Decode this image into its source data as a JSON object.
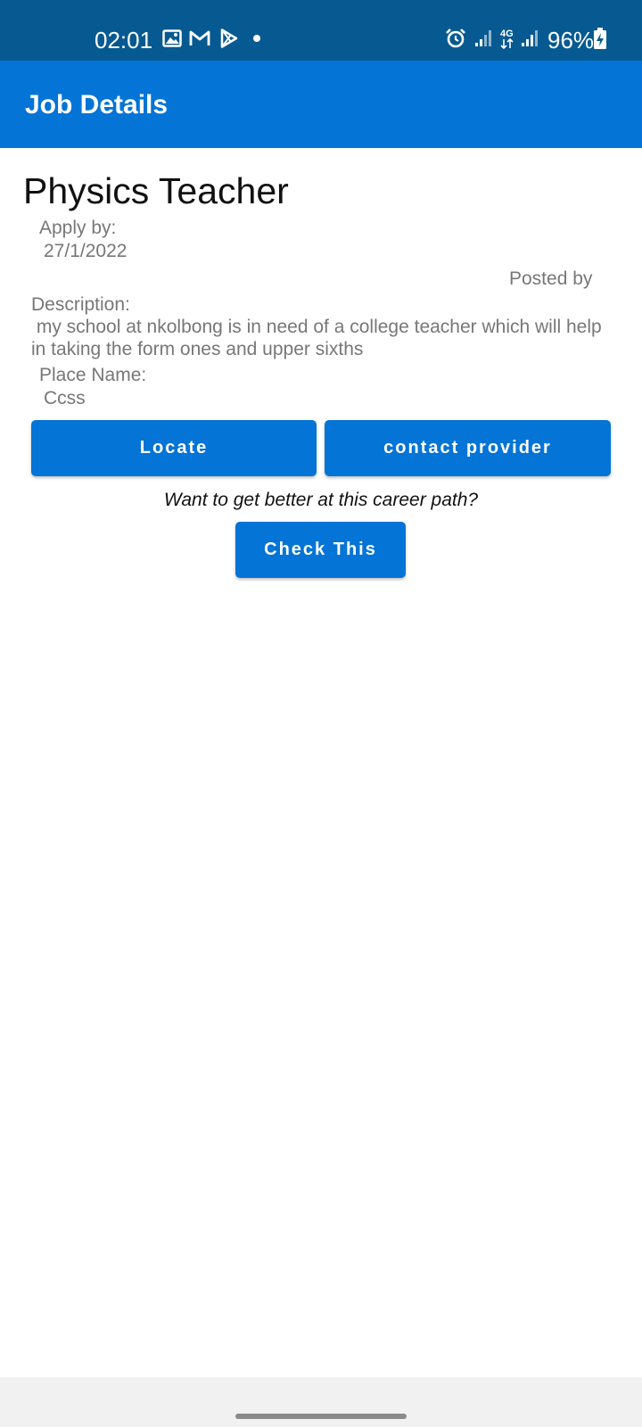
{
  "status_bar": {
    "time": "02:01",
    "battery": "96%",
    "icons": [
      "gallery-icon",
      "gmail-icon",
      "play-store-icon",
      "notification-dot-icon",
      "alarm-icon",
      "signal-icon",
      "4g-data-icon",
      "signal-icon",
      "battery-charging-icon"
    ]
  },
  "app_bar": {
    "title": "Job Details"
  },
  "job": {
    "title": "Physics Teacher",
    "apply_by_label": "Apply by:",
    "apply_by_value": "27/1/2022",
    "posted_by_label": "Posted by",
    "description_label": "Description:",
    "description_value": " my school at nkolbong is in need of a college teacher which will help in taking the form ones and upper sixths",
    "place_label": "Place Name:",
    "place_value": "Ccss"
  },
  "actions": {
    "locate": "Locate",
    "contact": "contact provider",
    "prompt": "Want to get better at this career path?",
    "check": "Check This"
  },
  "colors": {
    "status_bar": "#075a91",
    "app_bar": "#0474d6",
    "button": "#0474d6",
    "muted_text": "#777777"
  }
}
